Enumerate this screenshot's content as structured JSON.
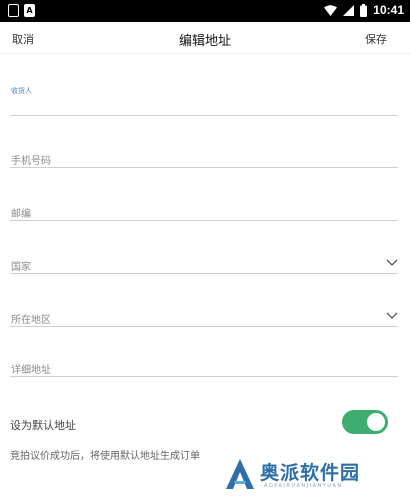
{
  "status_bar": {
    "time": "10:41"
  },
  "header": {
    "cancel_label": "取消",
    "title": "编辑地址",
    "save_label": "保存"
  },
  "form": {
    "recipient_label": "收货人",
    "phone_placeholder": "手机号码",
    "postcode_placeholder": "邮编",
    "country_placeholder": "国家",
    "region_placeholder": "所在地区",
    "detail_placeholder": "详细地址"
  },
  "default_switch": {
    "label": "设为默认地址",
    "on": true
  },
  "note": "竞拍议价成功后，将使用默认地址生成订单",
  "watermark": {
    "text": "奥派软件园",
    "sub": "AOPAIRUANJIANYUAN"
  },
  "colors": {
    "switch_on": "#3fad6e",
    "focused_label": "#4a7fd1",
    "watermark": "#2f6fa8"
  }
}
